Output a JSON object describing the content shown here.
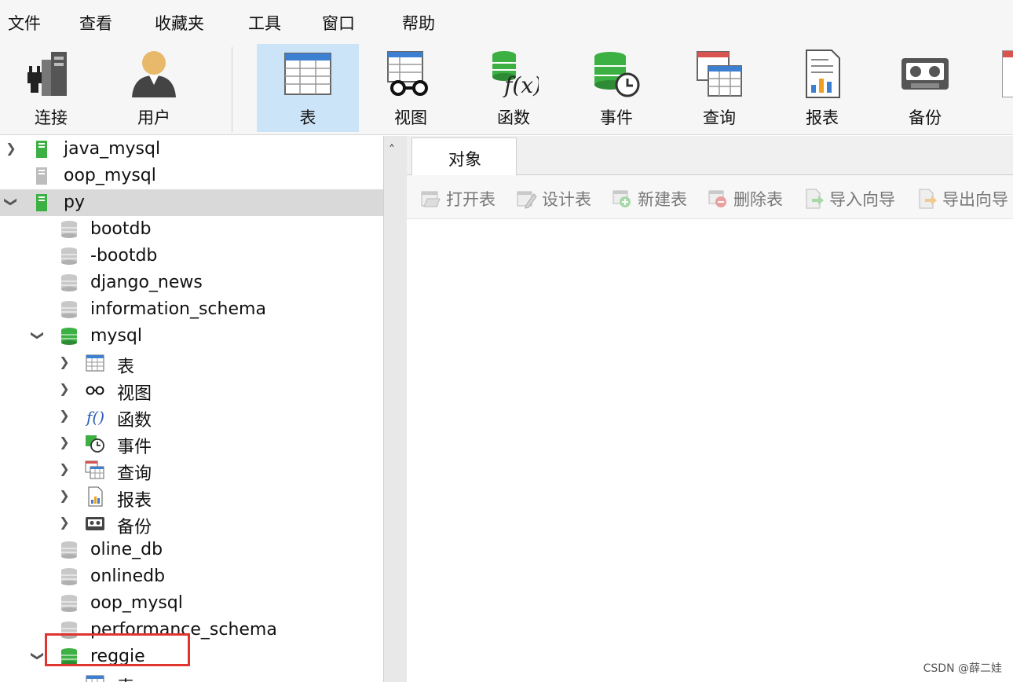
{
  "menubar": {
    "items": [
      "文件",
      "查看",
      "收藏夹",
      "工具",
      "窗口",
      "帮助"
    ]
  },
  "toolbar": {
    "buttons": [
      {
        "label": "连接",
        "icon": "connection-icon"
      },
      {
        "label": "用户",
        "icon": "user-icon"
      },
      {
        "label": "表",
        "icon": "table-icon",
        "active": true
      },
      {
        "label": "视图",
        "icon": "view-icon"
      },
      {
        "label": "函数",
        "icon": "function-icon"
      },
      {
        "label": "事件",
        "icon": "event-icon"
      },
      {
        "label": "查询",
        "icon": "query-icon"
      },
      {
        "label": "报表",
        "icon": "report-icon"
      },
      {
        "label": "备份",
        "icon": "backup-icon"
      }
    ]
  },
  "tree": {
    "rows": [
      {
        "label": "java_mysql",
        "icon": "server-icon",
        "state": "collapsed"
      },
      {
        "label": "oop_mysql",
        "icon": "server-icon-gray",
        "state": "none"
      },
      {
        "label": "py",
        "icon": "server-icon",
        "state": "expanded",
        "selected": true
      },
      {
        "label": "bootdb",
        "icon": "database-icon-gray"
      },
      {
        "label": "-bootdb",
        "icon": "database-icon-gray"
      },
      {
        "label": "django_news",
        "icon": "database-icon-gray"
      },
      {
        "label": "information_schema",
        "icon": "database-icon-gray"
      },
      {
        "label": "mysql",
        "icon": "database-icon-green",
        "state": "expanded"
      },
      {
        "label": "表",
        "icon": "table-icon",
        "state": "collapsed"
      },
      {
        "label": "视图",
        "icon": "view-icon",
        "state": "collapsed"
      },
      {
        "label": "函数",
        "icon": "function-icon",
        "state": "collapsed"
      },
      {
        "label": "事件",
        "icon": "event-icon",
        "state": "collapsed"
      },
      {
        "label": "查询",
        "icon": "query-icon",
        "state": "collapsed"
      },
      {
        "label": "报表",
        "icon": "report-icon",
        "state": "collapsed"
      },
      {
        "label": "备份",
        "icon": "backup-icon",
        "state": "collapsed"
      },
      {
        "label": "oline_db",
        "icon": "database-icon-gray"
      },
      {
        "label": "onlinedb",
        "icon": "database-icon-gray"
      },
      {
        "label": "oop_mysql",
        "icon": "database-icon-gray"
      },
      {
        "label": "performance_schema",
        "icon": "database-icon-gray"
      },
      {
        "label": "reggie",
        "icon": "database-icon-green",
        "state": "expanded"
      },
      {
        "label": "表",
        "icon": "table-icon"
      }
    ]
  },
  "tabs": {
    "objects_label": "对象"
  },
  "object_toolbar": {
    "buttons": [
      {
        "label": "打开表",
        "icon": "open-table-icon"
      },
      {
        "label": "设计表",
        "icon": "design-table-icon"
      },
      {
        "label": "新建表",
        "icon": "new-table-icon"
      },
      {
        "label": "删除表",
        "icon": "delete-table-icon"
      },
      {
        "label": "导入向导",
        "icon": "import-wizard-icon"
      },
      {
        "label": "导出向导",
        "icon": "export-wizard-icon"
      }
    ]
  },
  "watermark": "CSDN @薛二娃",
  "colors": {
    "accent": "#cce4f7",
    "green": "#3cb043",
    "highlight": "#e0342f"
  }
}
